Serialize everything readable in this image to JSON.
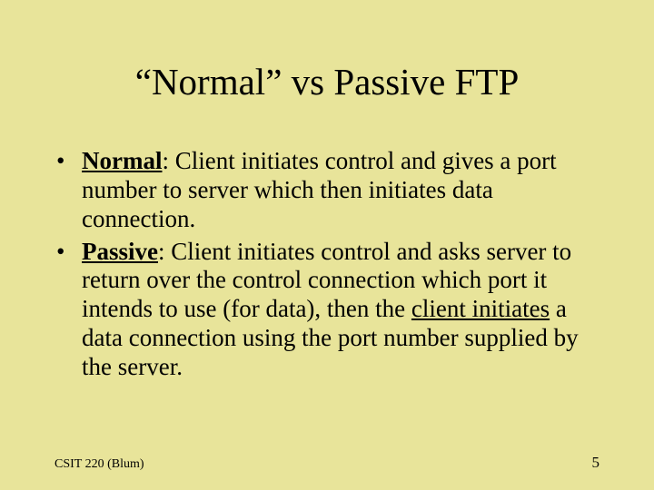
{
  "slide": {
    "title": "“Normal” vs Passive FTP",
    "bullets": [
      {
        "mark": "•",
        "label": "Normal",
        "sep": ": ",
        "tail": "Client initiates control and gives a port number to server which then initiates data connection."
      },
      {
        "mark": "•",
        "label": "Passive",
        "sep": ": ",
        "pre": "Client initiates control and asks server to return over the control connection which port it intends to use (for data), then the ",
        "mid": "client initiates",
        "post": " a data connection using the port number supplied by the server."
      }
    ],
    "footer_left": "CSIT 220 (Blum)",
    "footer_right": "5"
  }
}
